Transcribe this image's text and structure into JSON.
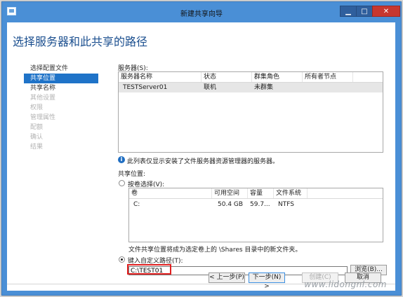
{
  "window": {
    "title": "新建共享向导",
    "minimize": "▁",
    "maximize": "□",
    "close": "✕"
  },
  "heading": "选择服务器和此共享的路径",
  "nav": [
    {
      "label": "选择配置文件",
      "state": "normal"
    },
    {
      "label": "共享位置",
      "state": "active"
    },
    {
      "label": "共享名称",
      "state": "normal"
    },
    {
      "label": "其他设置",
      "state": "disabled"
    },
    {
      "label": "权限",
      "state": "disabled"
    },
    {
      "label": "管理属性",
      "state": "disabled"
    },
    {
      "label": "配额",
      "state": "disabled"
    },
    {
      "label": "确认",
      "state": "disabled"
    },
    {
      "label": "结果",
      "state": "disabled"
    }
  ],
  "servers": {
    "label": "服务器(S):",
    "columns": [
      "服务器名称",
      "状态",
      "群集角色",
      "所有者节点"
    ],
    "rows": [
      {
        "name": "TESTServer01",
        "status": "联机",
        "role": "未群集",
        "owner": ""
      }
    ]
  },
  "info_text": "此列表仅显示安装了文件服务器资源管理器的服务器。",
  "share_location": {
    "label": "共享位置:",
    "by_volume_label": "按卷选择(V):",
    "volumes": {
      "columns": [
        "卷",
        "可用空间",
        "容量",
        "文件系统"
      ],
      "rows": [
        {
          "volume": "C:",
          "free": "50.4 GB",
          "capacity": "59.7...",
          "fs": "NTFS"
        }
      ]
    },
    "note": "文件共享位置将成为选定卷上的 \\Shares 目录中的新文件夹。",
    "custom_path_label": "键入自定义路径(T):",
    "custom_path_value": "C:\\TEST01",
    "browse": "浏览(B)..."
  },
  "footer": {
    "prev": "< 上一步(P)",
    "next": "下一步(N) >",
    "create": "创建(C)",
    "cancel": "取消"
  },
  "watermark": "www.lidongnl.com"
}
